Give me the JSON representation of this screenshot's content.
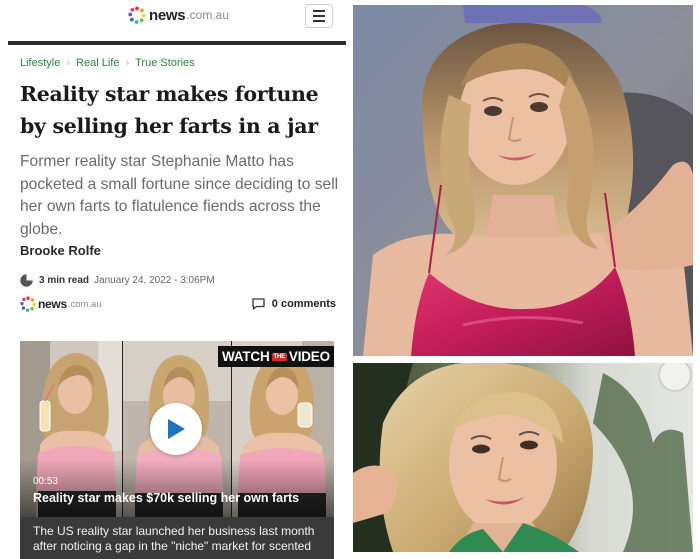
{
  "header": {
    "logo_word": "news",
    "logo_tld": ".com.au",
    "menu_icon": "hamburger-icon"
  },
  "breadcrumb": [
    "Lifestyle",
    "Real Life",
    "True Stories"
  ],
  "article": {
    "headline": "Reality star makes fortune by selling her farts in a jar",
    "standfirst": "Former reality star Stephanie Matto has pocketed a small fortune since deciding to sell her own farts to flatulence fiends across the globe.",
    "author": "Brooke Rolfe",
    "read_time": "3 min read",
    "timestamp": "January 24, 2022 - 3:06PM",
    "source_logo_word": "news",
    "source_logo_tld": ".com.au",
    "comments": "0 comments"
  },
  "video": {
    "badge_watch": "WATCH",
    "badge_the": "THE",
    "badge_video": "VIDEO",
    "duration": "00:53",
    "title": "Reality star makes $70k selling her own farts",
    "caption": "The US reality star launched her business last month after noticing a gap in the \"niche\" market for scented"
  },
  "colors": {
    "breadcrumb": "#2a8a3a",
    "rule": "#2e2e2e",
    "badge_red": "#d9262b",
    "play_blue": "#1e73be"
  },
  "icons": [
    "hamburger-icon",
    "chevron-right-icon",
    "clock-icon",
    "comment-icon",
    "play-icon"
  ]
}
